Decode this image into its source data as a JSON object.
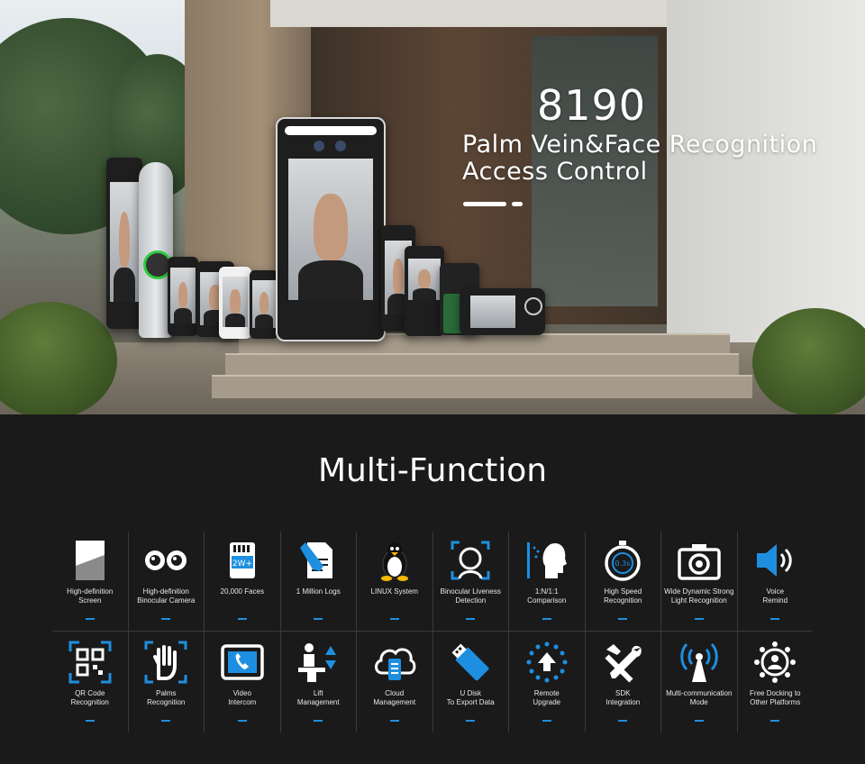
{
  "hero": {
    "model": "8190",
    "subtitle_line1": "Palm Vein&Face Recognition",
    "subtitle_line2": "Access Control"
  },
  "section_title": "Multi-Function",
  "accent_color": "#1e8fe0",
  "features_row1": [
    {
      "line1": "High-definition",
      "line2": "Screen",
      "icon": "screen-icon"
    },
    {
      "line1": "High-definition",
      "line2": "Binocular Camera",
      "icon": "binocular-camera-icon"
    },
    {
      "line1": "20,000 Faces",
      "line2": "",
      "icon": "memory-card-icon"
    },
    {
      "line1": "1 Million Logs",
      "line2": "",
      "icon": "document-edit-icon"
    },
    {
      "line1": "LINUX System",
      "line2": "",
      "icon": "linux-penguin-icon"
    },
    {
      "line1": "Binocular Liveness",
      "line2": "Detection",
      "icon": "face-scan-icon"
    },
    {
      "line1": "1:N/1:1",
      "line2": "Comparison",
      "icon": "face-compare-icon"
    },
    {
      "line1": "High Speed",
      "line2": "Recognition",
      "icon": "stopwatch-icon"
    },
    {
      "line1": "Wide Dynamic Strong",
      "line2": "Light Recognition",
      "icon": "camera-icon"
    },
    {
      "line1": "Voice",
      "line2": "Remind",
      "icon": "speaker-icon"
    }
  ],
  "stopwatch_text": "0.3s",
  "memory_text": "2W+",
  "features_row2": [
    {
      "line1": "QR Code",
      "line2": "Recognition",
      "icon": "qr-code-icon"
    },
    {
      "line1": "Palms",
      "line2": "Recognition",
      "icon": "palm-scan-icon"
    },
    {
      "line1": "Video",
      "line2": "Intercom",
      "icon": "video-phone-icon"
    },
    {
      "line1": "Lift",
      "line2": "Management",
      "icon": "lift-icon"
    },
    {
      "line1": "Cloud",
      "line2": "Management",
      "icon": "cloud-icon"
    },
    {
      "line1": "U Disk",
      "line2": "To Export Data",
      "icon": "usb-disk-icon"
    },
    {
      "line1": "Remote",
      "line2": "Upgrade",
      "icon": "remote-upgrade-icon"
    },
    {
      "line1": "SDK",
      "line2": "Integration",
      "icon": "tools-icon"
    },
    {
      "line1": "Multi-communication",
      "line2": "Mode",
      "icon": "antenna-icon"
    },
    {
      "line1": "Free Docking to",
      "line2": "Other Platforms",
      "icon": "platform-network-icon"
    }
  ]
}
